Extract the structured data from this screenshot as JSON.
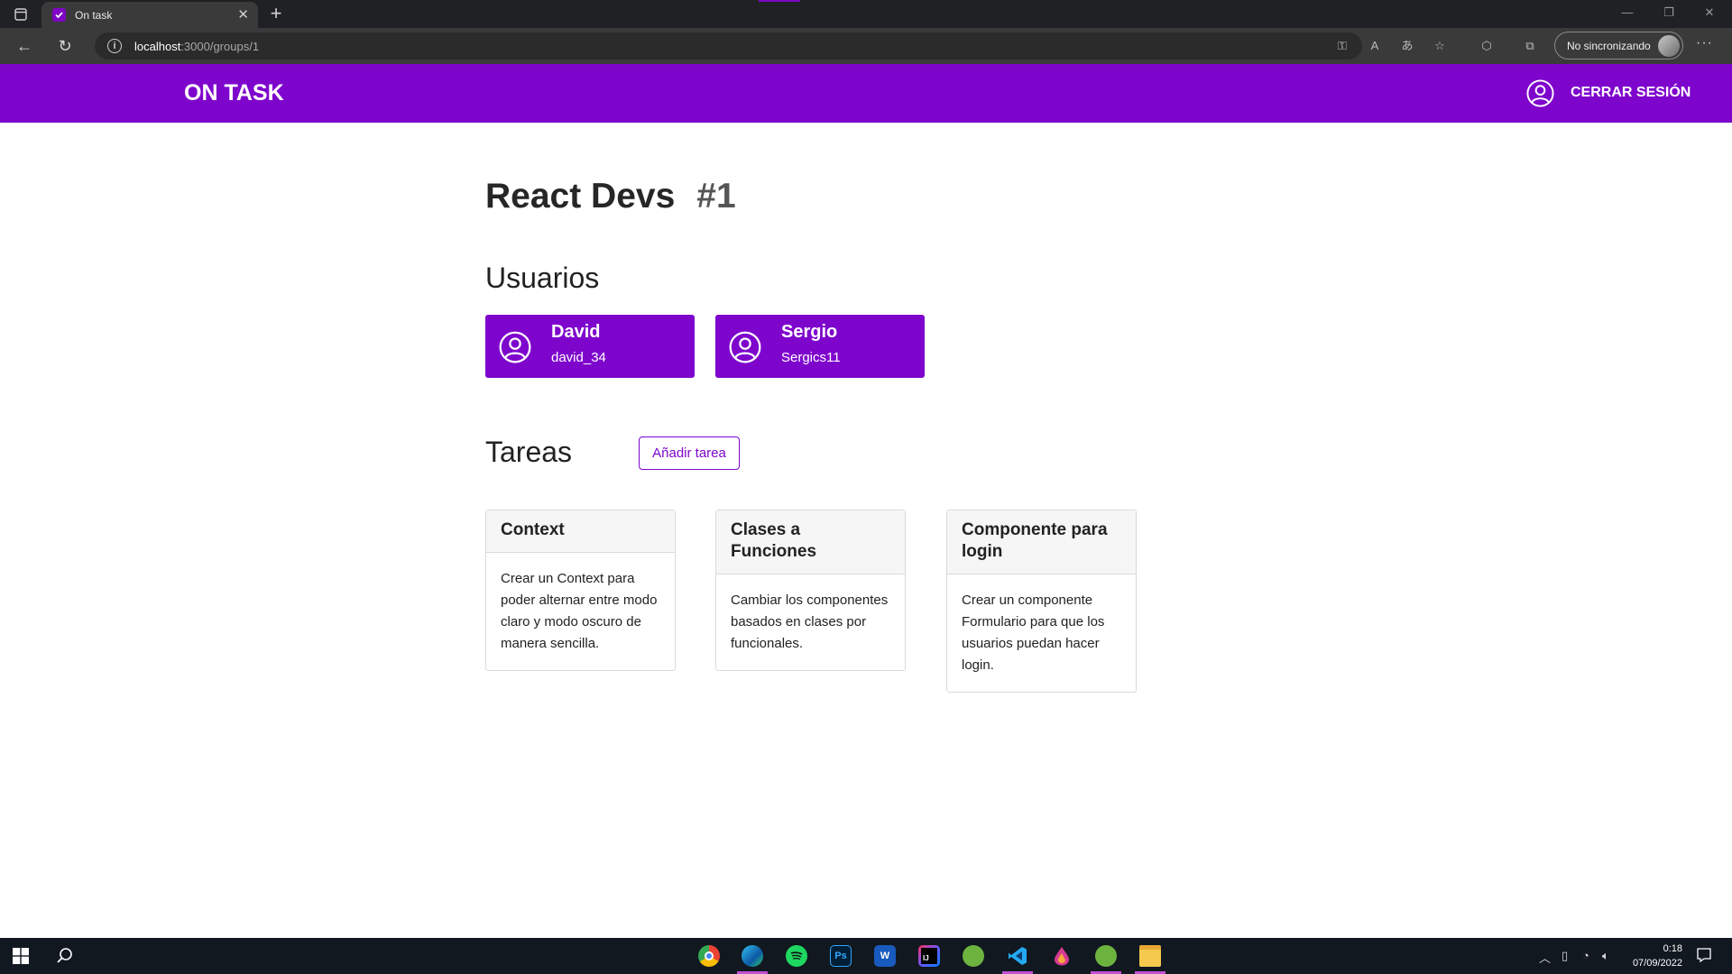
{
  "browser": {
    "tab_title": "On task",
    "url_host": "localhost",
    "url_path": ":3000/groups/1",
    "profile_label": "No sincronizando",
    "more_label": "···"
  },
  "app": {
    "brand": "ON TASK",
    "logout_label": "CERRAR SESIÓN",
    "accent_color": "#7e06cc"
  },
  "group": {
    "name": "React Devs",
    "id_label": "#1"
  },
  "users_section": {
    "title": "Usuarios",
    "users": [
      {
        "name": "David",
        "handle": "david_34"
      },
      {
        "name": "Sergio",
        "handle": "Sergics11"
      }
    ]
  },
  "tasks_section": {
    "title": "Tareas",
    "add_label": "Añadir tarea",
    "tasks": [
      {
        "title": "Context",
        "description": "Crear un Context para poder alternar entre modo claro y modo oscuro de manera sencilla."
      },
      {
        "title": "Clases a Funciones",
        "description": "Cambiar los componentes basados en clases por funcionales."
      },
      {
        "title": "Componente para login",
        "description": "Crear un componente Formulario para que los usuarios puedan hacer login."
      }
    ]
  },
  "taskbar": {
    "apps": [
      "chrome-icon",
      "edge-icon",
      "spotify-icon",
      "photoshop-icon",
      "word-icon",
      "intellij-icon",
      "spring-icon",
      "vscode-icon",
      "drop-icon",
      "spring-icon",
      "file-explorer-icon"
    ],
    "app_labels": {
      "photoshop": "Ps",
      "word": "W",
      "intellij": "IJ"
    },
    "time": "0:18",
    "date": "07/09/2022"
  }
}
